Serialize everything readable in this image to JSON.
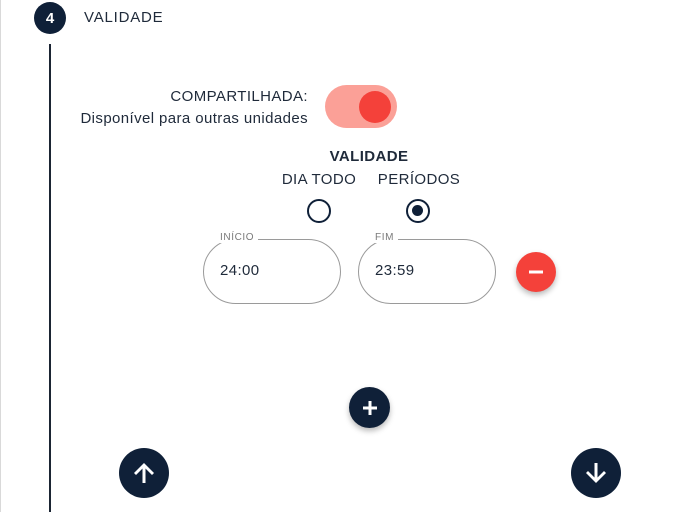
{
  "step": {
    "number": "4",
    "title": "VALIDADE"
  },
  "shared": {
    "label_line1": "COMPARTILHADA:",
    "label_line2": "Disponível para outras unidades",
    "enabled": true
  },
  "validity": {
    "title": "VALIDADE",
    "options": [
      {
        "label": "DIA TODO",
        "selected": false
      },
      {
        "label": "PERÍODOS",
        "selected": true
      }
    ]
  },
  "period": {
    "start_label": "INÍCIO",
    "start_value": "24:00",
    "end_label": "FIM",
    "end_value": "23:59"
  },
  "icons": {
    "remove": "minus-icon",
    "add": "plus-icon",
    "up": "arrow-up-icon",
    "down": "arrow-down-icon"
  },
  "colors": {
    "primary": "#0f2038",
    "danger": "#f4413a",
    "toggle_track": "#fba097"
  }
}
